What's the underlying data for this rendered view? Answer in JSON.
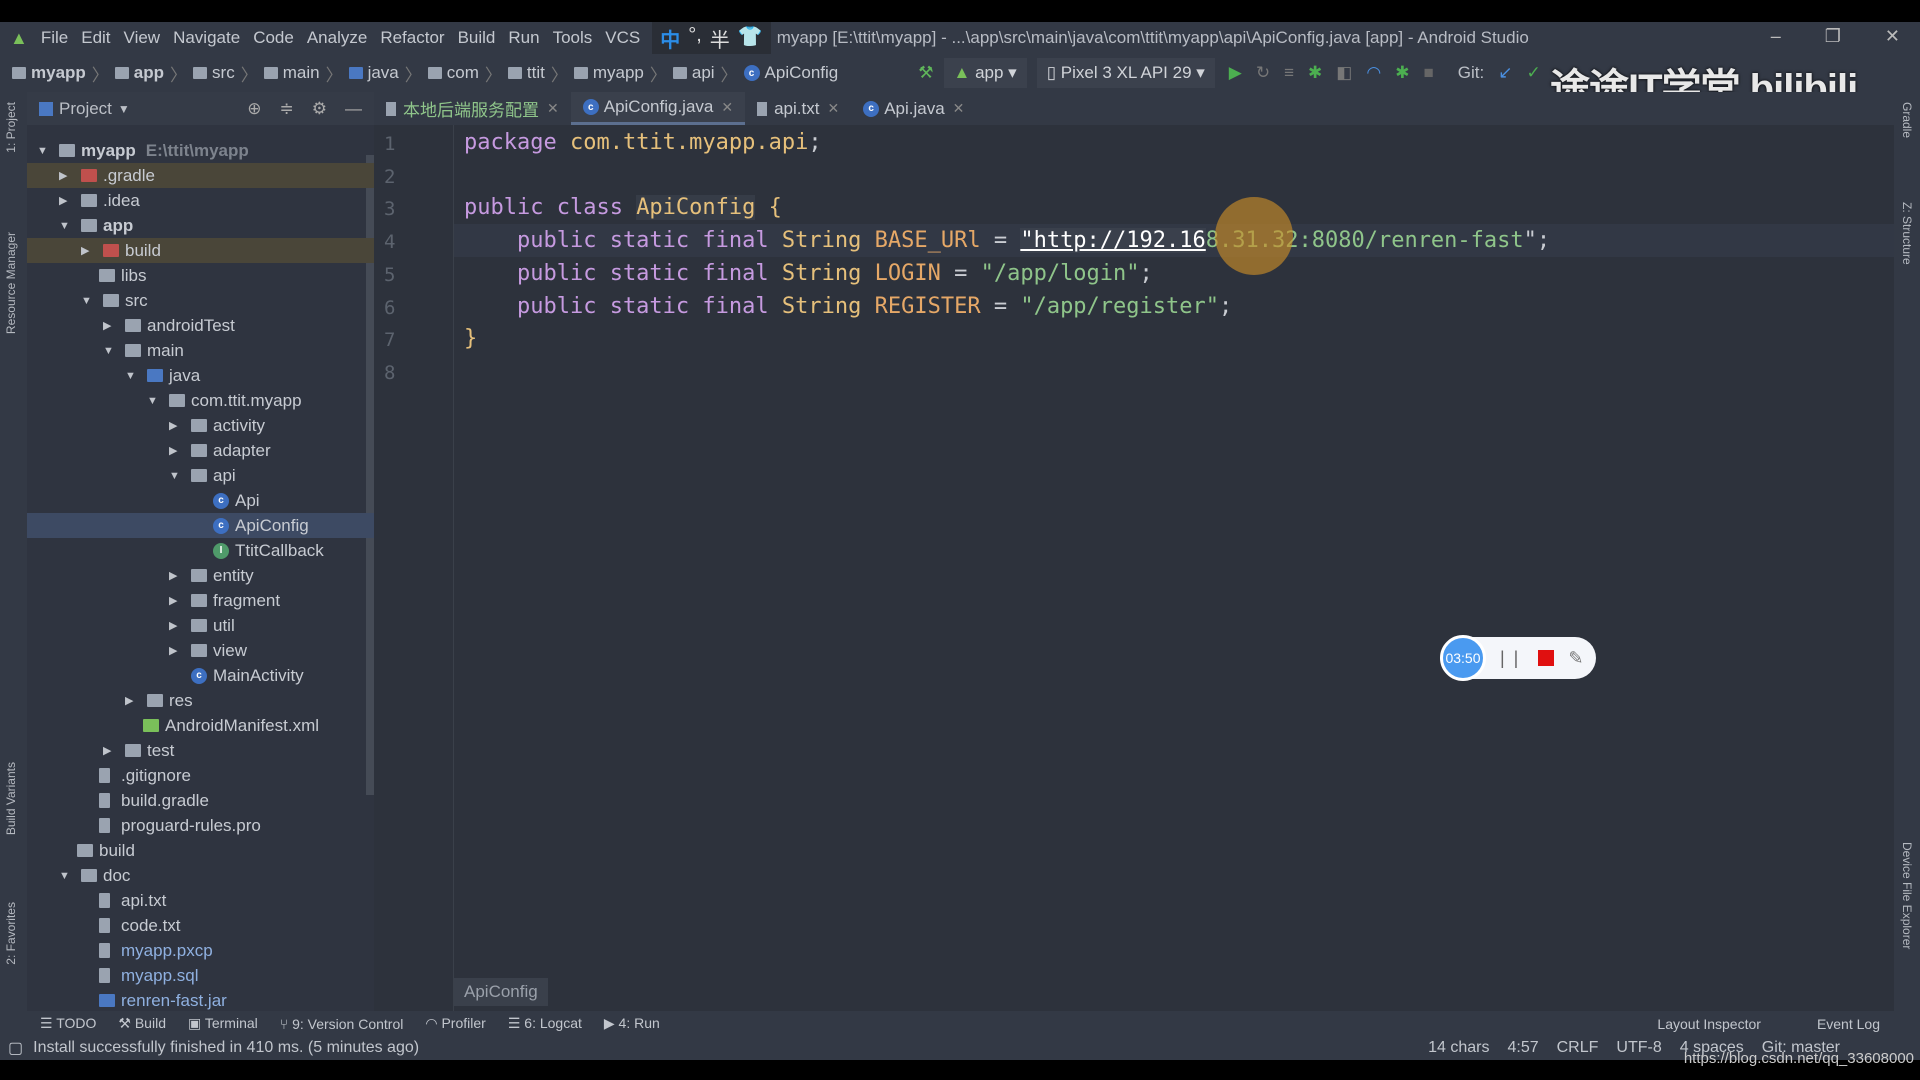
{
  "window": {
    "title": "myapp [E:\\ttit\\myapp] - ...\\app\\src\\main\\java\\com\\ttit\\myapp\\api\\ApiConfig.java [app] - Android Studio",
    "minimize": "–",
    "maximize": "❐",
    "close": "✕"
  },
  "menu": [
    "File",
    "Edit",
    "View",
    "Navigate",
    "Code",
    "Analyze",
    "Refactor",
    "Build",
    "Run",
    "Tools",
    "VCS"
  ],
  "ime": {
    "lang": "中",
    "punct": "°,",
    "width": "半",
    "skin": "👕"
  },
  "breadcrumb": [
    "myapp",
    "app",
    "src",
    "main",
    "java",
    "com",
    "ttit",
    "myapp",
    "api",
    "ApiConfig"
  ],
  "toolbar": {
    "config": "app",
    "device": "Pixel 3 XL API 29",
    "git_label": "Git:"
  },
  "watermark_logo": "途途IT学堂 bilibili",
  "project_panel": {
    "title": "Project"
  },
  "tree": [
    {
      "label": "myapp",
      "hint": "E:\\ttit\\myapp",
      "depth": 0,
      "arrow": "down",
      "bold": true,
      "icon": "module"
    },
    {
      "label": ".gradle",
      "depth": 1,
      "arrow": "right",
      "icon": "folder-excluded",
      "excluded": true
    },
    {
      "label": ".idea",
      "depth": 1,
      "arrow": "right",
      "icon": "folder"
    },
    {
      "label": "app",
      "depth": 1,
      "arrow": "down",
      "bold": true,
      "icon": "module"
    },
    {
      "label": "build",
      "depth": 2,
      "arrow": "right",
      "icon": "folder-excluded",
      "excluded": true
    },
    {
      "label": "libs",
      "depth": 2,
      "icon": "folder"
    },
    {
      "label": "src",
      "depth": 2,
      "arrow": "down",
      "icon": "folder"
    },
    {
      "label": "androidTest",
      "depth": 3,
      "arrow": "right",
      "icon": "folder"
    },
    {
      "label": "main",
      "depth": 3,
      "arrow": "down",
      "icon": "folder"
    },
    {
      "label": "java",
      "depth": 4,
      "arrow": "down",
      "icon": "folder-source"
    },
    {
      "label": "com.ttit.myapp",
      "depth": 5,
      "arrow": "down",
      "icon": "package"
    },
    {
      "label": "activity",
      "depth": 6,
      "arrow": "right",
      "icon": "package"
    },
    {
      "label": "adapter",
      "depth": 6,
      "arrow": "right",
      "icon": "package"
    },
    {
      "label": "api",
      "depth": 6,
      "arrow": "down",
      "icon": "package"
    },
    {
      "label": "Api",
      "depth": 7,
      "icon": "class"
    },
    {
      "label": "ApiConfig",
      "depth": 7,
      "icon": "class",
      "selected": true
    },
    {
      "label": "TtitCallback",
      "depth": 7,
      "icon": "interface"
    },
    {
      "label": "entity",
      "depth": 6,
      "arrow": "right",
      "icon": "package"
    },
    {
      "label": "fragment",
      "depth": 6,
      "arrow": "right",
      "icon": "package"
    },
    {
      "label": "util",
      "depth": 6,
      "arrow": "right",
      "icon": "package"
    },
    {
      "label": "view",
      "depth": 6,
      "arrow": "right",
      "icon": "package"
    },
    {
      "label": "MainActivity",
      "depth": 6,
      "icon": "class"
    },
    {
      "label": "res",
      "depth": 4,
      "arrow": "right",
      "icon": "folder"
    },
    {
      "label": "AndroidManifest.xml",
      "depth": 4,
      "icon": "manifest"
    },
    {
      "label": "test",
      "depth": 3,
      "arrow": "right",
      "icon": "folder"
    },
    {
      "label": ".gitignore",
      "depth": 2,
      "icon": "file"
    },
    {
      "label": "build.gradle",
      "depth": 2,
      "icon": "gradle"
    },
    {
      "label": "proguard-rules.pro",
      "depth": 2,
      "icon": "file"
    },
    {
      "label": "build",
      "depth": 1,
      "icon": "folder"
    },
    {
      "label": "doc",
      "depth": 1,
      "arrow": "down",
      "icon": "folder"
    },
    {
      "label": "api.txt",
      "depth": 2,
      "icon": "file"
    },
    {
      "label": "code.txt",
      "depth": 2,
      "icon": "file"
    },
    {
      "label": "myapp.pxcp",
      "depth": 2,
      "icon": "file",
      "color": "#8fb0e0"
    },
    {
      "label": "myapp.sql",
      "depth": 2,
      "icon": "file",
      "color": "#8fb0e0"
    },
    {
      "label": "renren-fast.jar",
      "depth": 2,
      "icon": "jar",
      "color": "#8fb0e0"
    }
  ],
  "tabs": [
    {
      "label": "本地后端服务配置",
      "icon": "text-file",
      "color": "#8fc58a"
    },
    {
      "label": "ApiConfig.java",
      "icon": "class",
      "active": true
    },
    {
      "label": "api.txt",
      "icon": "text-file"
    },
    {
      "label": "Api.java",
      "icon": "class"
    }
  ],
  "code": {
    "line_numbers": [
      "1",
      "2",
      "3",
      "4",
      "5",
      "6",
      "7",
      "8"
    ],
    "lines": [
      [
        [
          "kw",
          "package "
        ],
        [
          "ty",
          "com.ttit.myapp.api"
        ],
        [
          "pl",
          ";"
        ]
      ],
      [],
      [
        [
          "kw",
          "public class "
        ],
        [
          "cl",
          "ApiConfig"
        ],
        [
          "ty",
          " {"
        ]
      ],
      [
        [
          "kw",
          "    public static final "
        ],
        [
          "ty",
          "String "
        ],
        [
          "nm",
          "BASE_URl"
        ],
        [
          "pl",
          " = "
        ],
        [
          "url",
          "\"http://192.16"
        ],
        [
          "st",
          "8.31.32:8080/renren-fast"
        ],
        [
          "pl",
          "\";"
        ]
      ],
      [
        [
          "kw",
          "    public static final "
        ],
        [
          "ty",
          "String "
        ],
        [
          "nm",
          "LOGIN"
        ],
        [
          "pl",
          " = "
        ],
        [
          "st",
          "\"/app/login\""
        ],
        [
          "pl",
          ";"
        ]
      ],
      [
        [
          "kw",
          "    public static final "
        ],
        [
          "ty",
          "String "
        ],
        [
          "nm",
          "REGISTER"
        ],
        [
          "pl",
          " = "
        ],
        [
          "st",
          "\"/app/register\""
        ],
        [
          "pl",
          ";"
        ]
      ],
      [
        [
          "ty",
          "}"
        ]
      ],
      []
    ]
  },
  "editor_breadcrumb": "ApiConfig",
  "recorder": {
    "time": "03:50",
    "pause": "| |",
    "edit": "✎"
  },
  "left_stripe": [
    "1: Project",
    "Resource Manager",
    "Build Variants",
    "2: Favorites"
  ],
  "right_stripe": [
    "Gradle",
    "Z: Structure",
    "Device File Explorer"
  ],
  "bottom_tools": [
    "TODO",
    "Build",
    "Terminal",
    "9: Version Control",
    "Profiler",
    "6: Logcat",
    "4: Run"
  ],
  "bottom_right_tools": [
    "Layout Inspector",
    "Event Log"
  ],
  "status": {
    "message": "Install successfully finished in 410 ms. (5 minutes ago)",
    "chars": "14 chars",
    "position": "4:57",
    "line_sep": "CRLF",
    "encoding": "UTF-8",
    "indent": "4 spaces",
    "git": "Git: master"
  },
  "url_watermark": "https://blog.csdn.net/qq_33608000"
}
